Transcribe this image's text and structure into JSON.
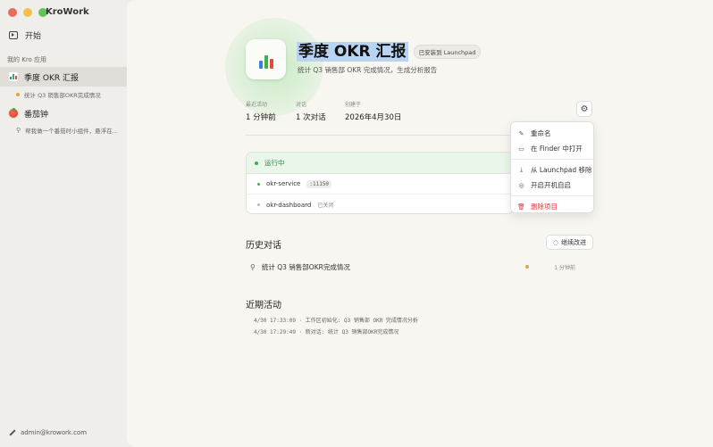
{
  "app": {
    "title": "KroWork"
  },
  "sidebar": {
    "start_label": "开始",
    "section_label": "我的 Kro 应用",
    "items": [
      {
        "label": "季度 OKR 汇报",
        "sub": "统计 Q3 销售部OKR完成情况"
      },
      {
        "label": "番茄钟",
        "sub": "帮我做一个番茄时小组件，悬浮在..."
      }
    ],
    "user_email": "admin@krowork.com"
  },
  "header": {
    "title": "季度 OKR 汇报",
    "badge": "已安装到 Launchpad",
    "subtitle": "统计 Q3 销售部 OKR 完成情况，生成分析报告"
  },
  "stats": [
    {
      "label": "最近活动",
      "value": "1 分钟前"
    },
    {
      "label": "对话",
      "value": "1 次对话"
    },
    {
      "label": "创建于",
      "value": "2026年4月30日"
    }
  ],
  "status": {
    "label": "运行中",
    "services": [
      {
        "name": "okr-service",
        "port": ":11150"
      },
      {
        "name": "okr-dashboard",
        "state": "已关闭"
      }
    ]
  },
  "menu": {
    "rename": "重命名",
    "open_finder": "在 Finder 中打开",
    "remove_launchpad": "从 Launchpad 移除",
    "autostart": "开启开机自启",
    "delete": "删除项目"
  },
  "history": {
    "title": "历史对话",
    "continue_label": "继续改进",
    "items": [
      {
        "label": "统计 Q3 销售部OKR完成情况",
        "time": "1 分钟前"
      }
    ]
  },
  "activity": {
    "title": "近期活动",
    "items": [
      "4/30 17:33:09 · 工作区初始化: Q3 销售部 OKR 完成情况分析",
      "4/30 17:29:49 · 新对话: 统计 Q3 销售部OKR完成情况"
    ]
  },
  "colors": {
    "accent_green": "#3fb04a",
    "danger": "#d13b3b",
    "selection": "#b8d4f2"
  }
}
